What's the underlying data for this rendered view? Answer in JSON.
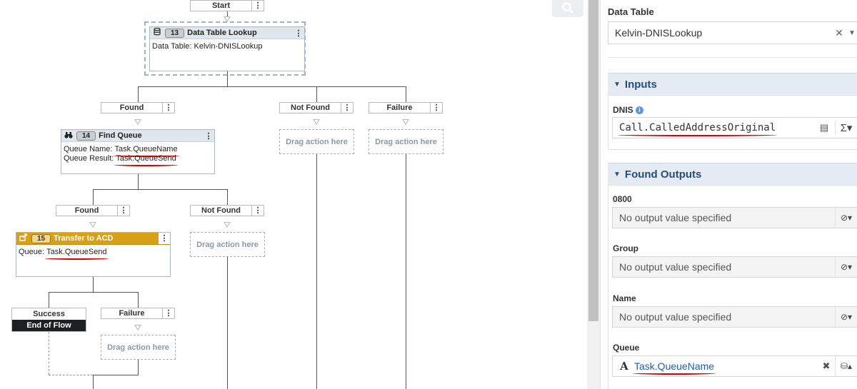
{
  "flow": {
    "start": "Start",
    "lookup": {
      "number": "13",
      "title": "Data Table Lookup",
      "line1_label": "Data Table:",
      "line1_value": "Kelvin-DNISLookup"
    },
    "outcomes1": [
      {
        "label": "Found"
      },
      {
        "label": "Not Found"
      },
      {
        "label": "Failure"
      }
    ],
    "find_queue": {
      "number": "14",
      "title": "Find Queue",
      "line1_label": "Queue Name:",
      "line1_value": "Task.QueueName",
      "line2_label": "Queue Result:",
      "line2_value": "Task.QueueSend"
    },
    "outcomes2": [
      {
        "label": "Found"
      },
      {
        "label": "Not Found"
      }
    ],
    "transfer": {
      "number": "15",
      "title": "Transfer to ACD",
      "line1_label": "Queue:",
      "line1_value": "Task.QueueSend"
    },
    "success_label": "Success",
    "end_of_flow": "End of Flow",
    "failure_label": "Failure",
    "drag_text": "Drag action here",
    "menu_glyph": "⋮",
    "icons": {
      "lookup": "database-icon",
      "find": "binoculars-icon",
      "transfer": "transfer-icon",
      "search": "search-icon"
    }
  },
  "panel": {
    "data_table_label": "Data Table",
    "data_table_value": "Kelvin-DNISLookup",
    "inputs_label": "Inputs",
    "dnis_label": "DNIS",
    "dnis_value": "Call.CalledAddressOriginal",
    "found_outputs_label": "Found Outputs",
    "outputs": [
      {
        "label": "0800",
        "value": "No output value specified"
      },
      {
        "label": "Group",
        "value": "No output value specified"
      },
      {
        "label": "Name",
        "value": "No output value specified"
      },
      {
        "label": "Queue",
        "value": "Task.QueueName"
      }
    ],
    "icons": {
      "clear": "close-icon",
      "dropdown": "chevron-down-icon",
      "info": "info-icon",
      "expression": "sigma-icon",
      "no_value": "no-value-icon",
      "string_type": "string-type-icon",
      "variable": "database-icon",
      "collapse": "caret-down-icon"
    }
  },
  "colors": {
    "accent": "#d8a016",
    "header": "#dfe6ee",
    "section": "#e4ebf3",
    "link": "#1d5fb5",
    "annotation": "#d00000"
  }
}
